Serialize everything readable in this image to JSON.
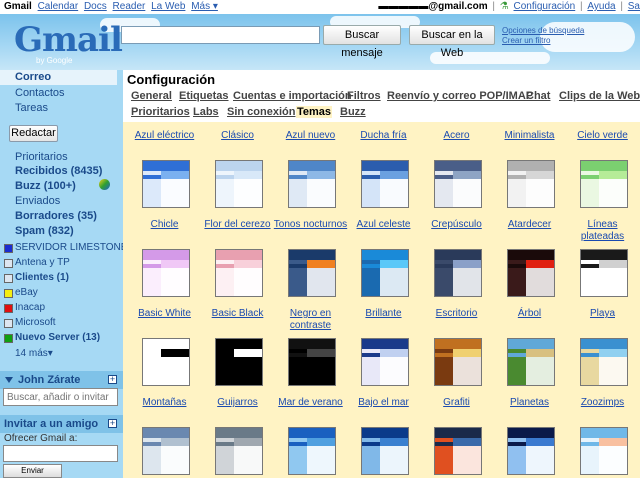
{
  "topbar": {
    "links": [
      "Gmail",
      "Calendar",
      "Docs",
      "Reader",
      "La Web",
      "Más ▾"
    ],
    "email": "▬▬▬▬▬@gmail.com",
    "right_links": [
      "Configuración",
      "Ayuda",
      "Sa"
    ]
  },
  "header": {
    "logo": "Gmail",
    "logo_sub": "by Google",
    "search_placeholder": "",
    "search_mail_button": "Buscar mensaje",
    "search_web_button": "Buscar en la Web",
    "search_options": "Opciones de búsqueda",
    "create_filter": "Crear un filtro"
  },
  "sidebar": {
    "mail": "Correo",
    "contacts": "Contactos",
    "tasks": "Tareas",
    "compose": "Redactar",
    "folders": [
      {
        "label": "Prioritarios"
      },
      {
        "label": "Recibidos (8435)"
      },
      {
        "label": "Buzz (100+)"
      },
      {
        "label": "Enviados"
      },
      {
        "label": "Borradores (35)"
      },
      {
        "label": "Spam (832)"
      }
    ],
    "labels": [
      {
        "label": "SERVIDOR LIMESTONE",
        "color": "#1a2cd0"
      },
      {
        "label": "Antena y TP",
        "color": "#dde6f0"
      },
      {
        "label": "Clientes (1)",
        "color": "#dde6f0"
      },
      {
        "label": "eBay",
        "color": "#f5ee10"
      },
      {
        "label": "Inacap",
        "color": "#e01010"
      },
      {
        "label": "Microsoft",
        "color": "#dde6f0"
      },
      {
        "label": "Nuevo Server (13)",
        "color": "#10a010"
      }
    ],
    "more": "14 más▾",
    "contact_name": "John Zárate",
    "contact_search_placeholder": "Buscar, añadir o invitar",
    "invite_title": "Invitar a un amigo",
    "invite_text": "Ofrecer Gmail a:",
    "invite_button": "Enviar invitación"
  },
  "main": {
    "title": "Configuración",
    "tabs_row1": [
      "General",
      "Etiquetas",
      "Cuentas e importación",
      "Filtros",
      "Reenvío y correo POP/IMAP",
      "Chat",
      "Clips de la Web"
    ],
    "tabs_row2": [
      "Prioritarios",
      "Labs",
      "Sin conexión",
      "Temas",
      "Buzz"
    ],
    "active_tab": "Temas"
  },
  "themes": [
    {
      "name": "Azul eléctrico",
      "colors": [
        "#2f6fd6",
        "#7ab0f0",
        "#dce9fa"
      ]
    },
    {
      "name": "Clásico",
      "colors": [
        "#bcd4ee",
        "#d8e8f8",
        "#eef5fc"
      ]
    },
    {
      "name": "Azul nuevo",
      "colors": [
        "#4f86c8",
        "#8db8e6",
        "#dfe9f5"
      ]
    },
    {
      "name": "Ducha fría",
      "colors": [
        "#2b5dae",
        "#6aa0e0",
        "#d4e4f8"
      ]
    },
    {
      "name": "Acero",
      "colors": [
        "#4a5e88",
        "#8ea4c4",
        "#e4e8f0"
      ]
    },
    {
      "name": "Minimalista",
      "colors": [
        "#b0b0b0",
        "#d6d6d6",
        "#f2f2f2"
      ]
    },
    {
      "name": "Cielo verde",
      "colors": [
        "#7bd070",
        "#b6ec98",
        "#eaf8e2"
      ]
    },
    {
      "name": "Chicle",
      "colors": [
        "#d49ae8",
        "#f0c8f6",
        "#fbeefd"
      ]
    },
    {
      "name": "Flor del cerezo",
      "colors": [
        "#e8a0b0",
        "#f8d0da",
        "#fdf0f3"
      ]
    },
    {
      "name": "Tonos nocturnos",
      "colors": [
        "#1a3a6a",
        "#f08020",
        "#3a5a8a"
      ]
    },
    {
      "name": "Azul celeste",
      "colors": [
        "#1a8ad8",
        "#5ac8f8",
        "#1a6ab0"
      ]
    },
    {
      "name": "Crepúsculo",
      "colors": [
        "#2a3a5a",
        "#8aa0c8",
        "#3a4a6a"
      ]
    },
    {
      "name": "Atardecer",
      "colors": [
        "#1a0a0a",
        "#e02010",
        "#3a1a1a"
      ]
    },
    {
      "name": "Líneas plateadas",
      "colors": [
        "#1a1a1a",
        "#d0d0d0",
        "#ffffff"
      ]
    },
    {
      "name": "Basic White",
      "colors": [
        "#ffffff",
        "#000000",
        "#ffffff"
      ]
    },
    {
      "name": "Basic Black",
      "colors": [
        "#000000",
        "#ffffff",
        "#000000"
      ]
    },
    {
      "name": "Negro en contraste",
      "colors": [
        "#111111",
        "#444444",
        "#000000"
      ]
    },
    {
      "name": "Brillante",
      "colors": [
        "#1a3a8a",
        "#c0d0f0",
        "#e8e8f8"
      ]
    },
    {
      "name": "Escritorio",
      "colors": [
        "#c07020",
        "#f0d070",
        "#7a3a10"
      ]
    },
    {
      "name": "Árbol",
      "colors": [
        "#60a8d8",
        "#d8c080",
        "#4a8a30"
      ]
    },
    {
      "name": "Playa",
      "colors": [
        "#3a90d0",
        "#90d0f0",
        "#e8d8a0"
      ]
    },
    {
      "name": "Montañas",
      "colors": [
        "#6a88b0",
        "#b0c0d0",
        "#dde6ee"
      ]
    },
    {
      "name": "Guijarros",
      "colors": [
        "#6a7a88",
        "#a0a8b0",
        "#d0d4d8"
      ]
    },
    {
      "name": "Mar de verano",
      "colors": [
        "#1a60c0",
        "#50a0e0",
        "#90c8f0"
      ]
    },
    {
      "name": "Bajo el mar",
      "colors": [
        "#0a3a8a",
        "#3a80d0",
        "#80b8e8"
      ]
    },
    {
      "name": "Grafiti",
      "colors": [
        "#1a2a4a",
        "#3a6aaa",
        "#e05020"
      ]
    },
    {
      "name": "Planetas",
      "colors": [
        "#0a1a4a",
        "#3a7ad0",
        "#90c0f0"
      ]
    },
    {
      "name": "Zoozimps",
      "colors": [
        "#70b8e8",
        "#f8c0a0",
        "#e8f4fc"
      ]
    }
  ]
}
